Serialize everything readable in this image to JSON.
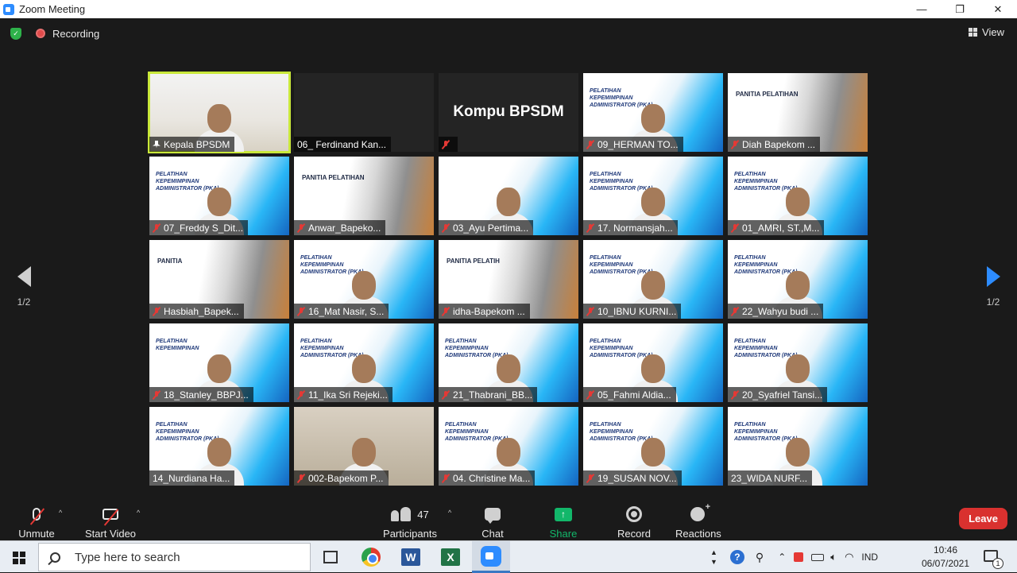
{
  "window": {
    "title": "Zoom Meeting",
    "controls": {
      "minimize": "—",
      "restore": "❐",
      "close": "✕"
    }
  },
  "topbar": {
    "recording_label": "Recording",
    "view_label": "View"
  },
  "colors": {
    "active_speaker_border": "#c9e83a",
    "leave_button": "#d9312f",
    "share_screen": "#12b76a",
    "muted_icon": "#e53935",
    "next_arrow": "#2d8cff"
  },
  "pagination": {
    "left": "1/2",
    "right": "1/2"
  },
  "tiles": [
    {
      "name": "Kepala BPSDM",
      "type": "video-office",
      "muted": false,
      "pinned": true,
      "active": true
    },
    {
      "name": "06_ Ferdinand Kan...",
      "type": "blank",
      "muted": false,
      "pinned": false,
      "active": false
    },
    {
      "name": "",
      "type": "name-card",
      "display_name": "Kompu BPSDM",
      "muted": true,
      "pinned": false,
      "active": false
    },
    {
      "name": "09_HERMAN TO...",
      "type": "video-slide",
      "slide_text": "PELATIHAN KEPEMIMPINAN ADMINISTRATOR (PKA)",
      "muted": true
    },
    {
      "name": "Diah Bapekom ...",
      "type": "building",
      "slide_text": "PANITIA PELATIHAN",
      "muted": true
    },
    {
      "name": "07_Freddy S_Dit...",
      "type": "video-slide",
      "slide_text": "PELATIHAN KEPEMIMPINAN ADMINISTRATOR (PKA)",
      "muted": true
    },
    {
      "name": "Anwar_Bapeko...",
      "type": "building",
      "slide_text": "PANITIA PELATIHAN",
      "muted": true
    },
    {
      "name": "03_Ayu Pertima...",
      "type": "video-slide",
      "slide_text": "",
      "muted": true
    },
    {
      "name": "17. Normansjah...",
      "type": "video-slide",
      "slide_text": "PELATIHAN KEPEMIMPINAN ADMINISTRATOR (PKA)",
      "muted": true
    },
    {
      "name": "01_AMRI, ST.,M...",
      "type": "video-slide",
      "slide_text": "PELATIHAN KEPEMIMPINAN ADMINISTRATOR (PKA)",
      "muted": true
    },
    {
      "name": "Hasbiah_Bapek...",
      "type": "building",
      "slide_text": "PANITIA",
      "muted": true
    },
    {
      "name": "16_Mat Nasir, S...",
      "type": "video-slide",
      "slide_text": "PELATIHAN KEPEMIMPINAN ADMINISTRATOR (PKA)",
      "muted": true
    },
    {
      "name": "idha-Bapekom ...",
      "type": "building",
      "slide_text": "PANITIA PELATIH",
      "muted": true
    },
    {
      "name": "10_IBNU KURNI...",
      "type": "video-slide",
      "slide_text": "PELATIHAN KEPEMIMPINAN ADMINISTRATOR (PKA)",
      "muted": true
    },
    {
      "name": "22_Wahyu budi ...",
      "type": "video-slide",
      "slide_text": "PELATIHAN KEPEMIMPINAN ADMINISTRATOR (PKA)",
      "muted": true
    },
    {
      "name": "18_Stanley_BBPJ...",
      "type": "video-slide",
      "slide_text": "PELATIHAN KEPEMIMPINAN",
      "muted": true
    },
    {
      "name": "11_Ika Sri Rejeki...",
      "type": "video-slide",
      "slide_text": "PELATIHAN KEPEMIMPINAN ADMINISTRATOR (PKA)",
      "muted": true
    },
    {
      "name": "21_Thabrani_BB...",
      "type": "video-slide",
      "slide_text": "PELATIHAN KEPEMIMPINAN ADMINISTRATOR (PKA)",
      "muted": true
    },
    {
      "name": "05_Fahmi Aldia...",
      "type": "video-slide",
      "slide_text": "PELATIHAN KEPEMIMPINAN ADMINISTRATOR (PKA)",
      "muted": true
    },
    {
      "name": "20_Syafriel Tansi...",
      "type": "video-slide",
      "slide_text": "PELATIHAN KEPEMIMPINAN ADMINISTRATOR (PKA)",
      "muted": true
    },
    {
      "name": "14_Nurdiana Ha...",
      "type": "video-slide",
      "slide_text": "PELATIHAN KEPEMIMPINAN ADMINISTRATOR (PKA)",
      "muted": false
    },
    {
      "name": "002-Bapekom P...",
      "type": "video-room",
      "slide_text": "",
      "muted": true
    },
    {
      "name": "04. Christine Ma...",
      "type": "video-slide",
      "slide_text": "PELATIHAN KEPEMIMPINAN ADMINISTRATOR (PKA)",
      "muted": true
    },
    {
      "name": "19_SUSAN NOV...",
      "type": "video-slide",
      "slide_text": "PELATIHAN KEPEMIMPINAN ADMINISTRATOR (PKA)",
      "muted": true
    },
    {
      "name": "23_WIDA NURF...",
      "type": "video-slide",
      "slide_text": "PELATIHAN KEPEMIMPINAN ADMINISTRATOR (PKA)",
      "muted": false
    }
  ],
  "toolbar": {
    "unmute": "Unmute",
    "start_video": "Start Video",
    "participants": "Participants",
    "participants_count": "47",
    "chat": "Chat",
    "share_screen": "Share Screen",
    "record": "Record",
    "reactions": "Reactions",
    "leave": "Leave",
    "caret": "^"
  },
  "taskbar": {
    "search_placeholder": "Type here to search",
    "word_letter": "W",
    "excel_letter": "X",
    "language": "IND",
    "time": "10:46",
    "date": "06/07/2021",
    "notification_count": "1"
  }
}
